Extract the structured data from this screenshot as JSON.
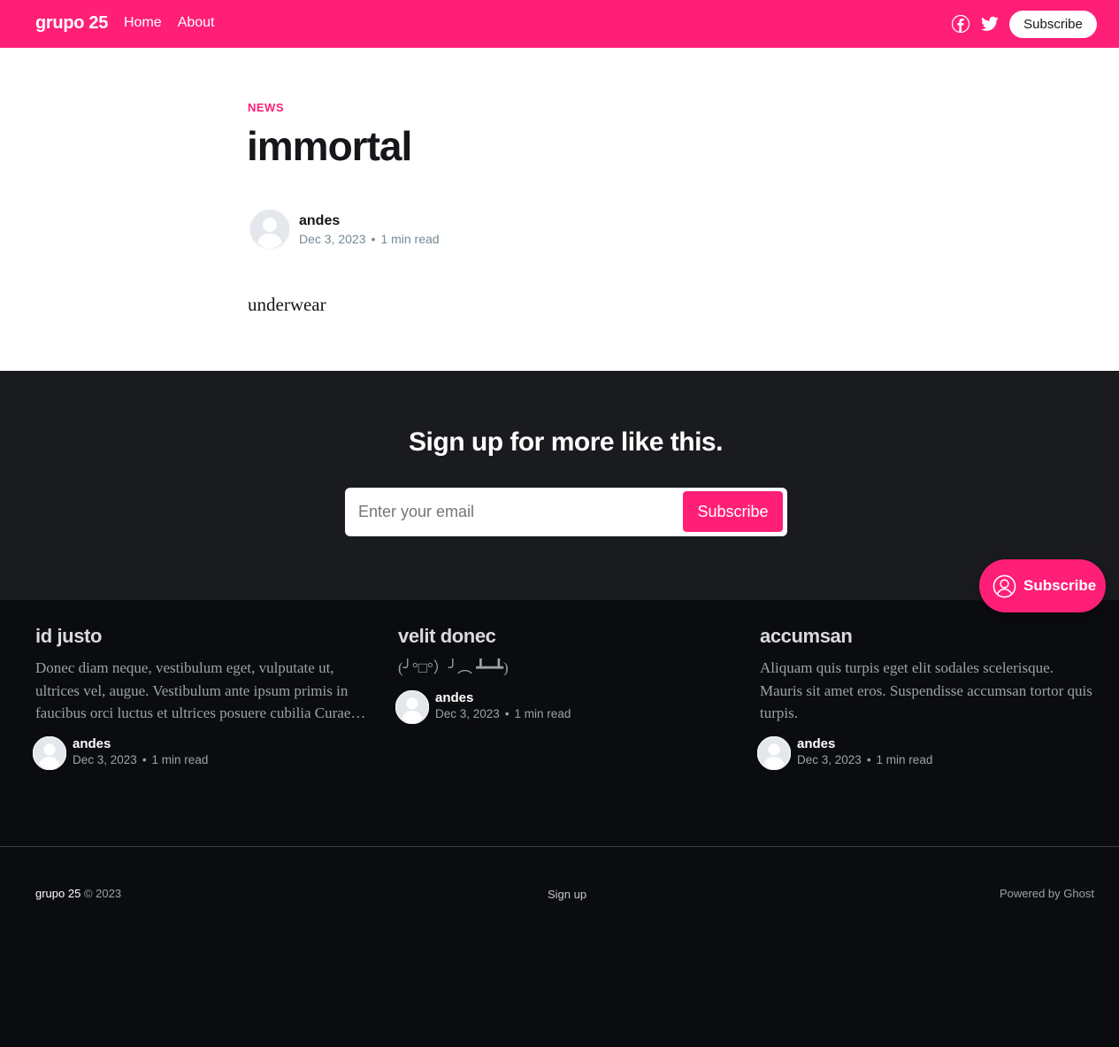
{
  "colors": {
    "accent": "#ff1f77",
    "dark_band": "#1a1b1f",
    "footer_bg": "#0b0c0f"
  },
  "header": {
    "brand": "grupo 25",
    "nav": [
      "Home",
      "About"
    ],
    "icons": [
      "facebook-icon",
      "twitter-icon"
    ],
    "subscribe_label": "Subscribe"
  },
  "article": {
    "tag": "NEWS",
    "title": "immortal",
    "author": "andes",
    "date": "Dec 3, 2023",
    "read_time": "1 min read",
    "body": "underwear"
  },
  "signup": {
    "title": "Sign up for more like this.",
    "placeholder": "Enter your email",
    "button": "Subscribe"
  },
  "floating_subscribe": {
    "label": "Subscribe",
    "icon": "user-circle-icon"
  },
  "related": [
    {
      "title": "id justo",
      "excerpt": "Donec diam neque, vestibulum eget, vulputate ut, ultrices vel, augue. Vestibulum ante ipsum primis in faucibus orci luctus et ultrices posuere cubilia Curae…",
      "author": "andes",
      "date": "Dec 3, 2023",
      "read_time": "1 min read"
    },
    {
      "title": "velit donec",
      "excerpt": "(╯°□°）╯︵ ┻━┻)",
      "author": "andes",
      "date": "Dec 3, 2023",
      "read_time": "1 min read"
    },
    {
      "title": "accumsan",
      "excerpt": "Aliquam quis turpis eget elit sodales scelerisque. Mauris sit amet eros. Suspendisse accumsan tortor quis turpis.",
      "author": "andes",
      "date": "Dec 3, 2023",
      "read_time": "1 min read"
    }
  ],
  "footer": {
    "brand": "grupo 25",
    "copyright": "© 2023",
    "signup_link": "Sign up",
    "powered": "Powered by Ghost"
  }
}
